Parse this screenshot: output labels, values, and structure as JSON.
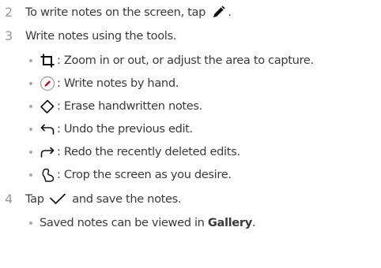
{
  "steps": [
    {
      "number": "2",
      "text_before": "To write notes on the screen, tap ",
      "icon": "pen-icon",
      "text_after": "."
    },
    {
      "number": "3",
      "text": "Write notes using the tools."
    },
    {
      "number": "4",
      "text_before": "Tap ",
      "icon": "checkmark-icon",
      "text_after": " and save the notes."
    }
  ],
  "tools": [
    {
      "icon": "crop-icon",
      "text": ": Zoom in or out, or adjust the area to capture."
    },
    {
      "icon": "pen-circle-icon",
      "text": ": Write notes by hand."
    },
    {
      "icon": "eraser-icon",
      "text": ": Erase handwritten notes."
    },
    {
      "icon": "undo-icon",
      "text": ": Undo the previous edit."
    },
    {
      "icon": "redo-icon",
      "text": ": Redo the recently deleted edits."
    },
    {
      "icon": "lasso-crop-icon",
      "text": ": Crop the screen as you desire."
    }
  ],
  "note": {
    "text_before": "Saved notes can be viewed in ",
    "bold": "Gallery",
    "text_after": "."
  },
  "colors": {
    "text": "#3a3a3a",
    "number": "#9a9a9a",
    "bullet": "#a8a8a8",
    "pen_circle_accent": "#d0021b"
  }
}
